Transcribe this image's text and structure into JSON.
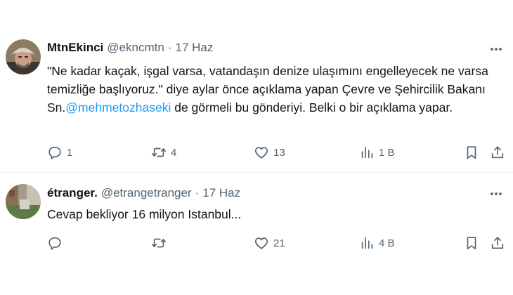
{
  "tweets": [
    {
      "author": {
        "display_name": "MtnEkinci",
        "handle": "@ekncmtn"
      },
      "separator": "·",
      "time": "17 Haz",
      "text_parts": [
        "\"Ne kadar kaçak, işgal varsa, vatandaşın denize ulaşımını engelleyecek ne varsa temizliğe başlıyoruz.\" diye aylar önce açıklama yapan Çevre ve Şehircilik Bakanı Sn.",
        "@mehmetozhaseki",
        " de görmeli bu gönderiyi. Belki o bir açıklama yapar."
      ],
      "stats": {
        "replies": "1",
        "retweets": "4",
        "likes": "13",
        "views": "1 B"
      },
      "avatar_icon": "man-with-cap-avatar"
    },
    {
      "author": {
        "display_name": "étranger.",
        "handle": "@etrangetranger"
      },
      "separator": "·",
      "time": "17 Haz",
      "text": "Cevap bekliyor 16 milyon Istanbul...",
      "stats": {
        "replies": "",
        "retweets": "",
        "likes": "21",
        "views": "4 B"
      },
      "avatar_icon": "street-photo-avatar"
    }
  ],
  "icons": {
    "reply": "speech-bubble-icon",
    "retweet": "retweet-arrows-icon",
    "like": "heart-icon",
    "views": "bar-chart-icon",
    "bookmark": "bookmark-icon",
    "share": "share-upload-icon",
    "more": "more-dots-icon"
  },
  "colors": {
    "text": "#0f1419",
    "secondary": "#536471",
    "link": "#1d9bf0",
    "divider": "#eff3f4"
  }
}
